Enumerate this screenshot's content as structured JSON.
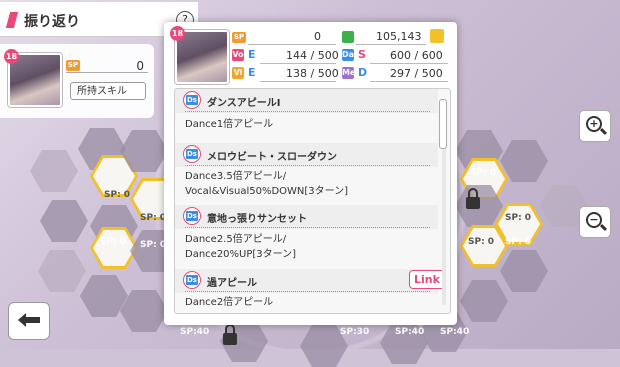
{
  "header": {
    "title": "振り返り",
    "help_label": "?"
  },
  "left_card": {
    "ribbon": "18",
    "sp_label": "SP",
    "sp_value": "0",
    "skill_button": "所持スキル"
  },
  "dialog": {
    "ribbon": "18",
    "sp_label": "SP",
    "sp_value": "0",
    "fans_value": "105,143",
    "stats": [
      {
        "icon": "Vo",
        "rank": "E",
        "value": "144 / 500",
        "icon_color": "#e8497a",
        "rank_color": "#3a8ee6"
      },
      {
        "icon": "Da",
        "rank": "S",
        "value": "600 / 600",
        "icon_color": "#3a8ee6",
        "rank_color": "#e8497a"
      },
      {
        "icon": "Vi",
        "rank": "E",
        "value": "138 / 500",
        "icon_color": "#f1a52a",
        "rank_color": "#3a8ee6"
      },
      {
        "icon": "Me",
        "rank": "D",
        "value": "297 / 500",
        "icon_color": "#9c6fd6",
        "rank_color": "#3a8ee6"
      }
    ],
    "skills": [
      {
        "name": "ダンスアピールⅠ",
        "desc": [
          "Dance1倍アピール"
        ],
        "link": ""
      },
      {
        "name": "メロウビート・スローダウン",
        "desc": [
          "Dance3.5倍アピール/",
          "Vocal&Visual50%DOWN[3ターン]"
        ],
        "link": ""
      },
      {
        "name": "意地っ張りサンセット",
        "desc": [
          "Dance2.5倍アピール/",
          "Dance20%UP[3ターン]"
        ],
        "link": ""
      },
      {
        "name": "過アピール",
        "desc": [
          "Dance2倍アピール"
        ],
        "link": "Link"
      }
    ]
  },
  "board": {
    "sp_tags": [
      "SP: 0",
      "SP: 0",
      "SP: 0",
      "SP: 0",
      "SP: 0",
      "SP: 0",
      "SP: 0",
      "SP: 0",
      "SP:40",
      "SP:30",
      "SP:40",
      "SP:40"
    ],
    "node_label": "Da"
  },
  "colors": {
    "accent": "#e8497a",
    "dance": "#3a8ee6",
    "gold": "#f1c02a"
  },
  "icons": {
    "zoom_in": "zoom-in-icon",
    "zoom_out": "zoom-out-icon",
    "back": "back-arrow-icon",
    "lock": "lock-icon",
    "fans": "fans-icon",
    "crown": "crown-icon"
  }
}
